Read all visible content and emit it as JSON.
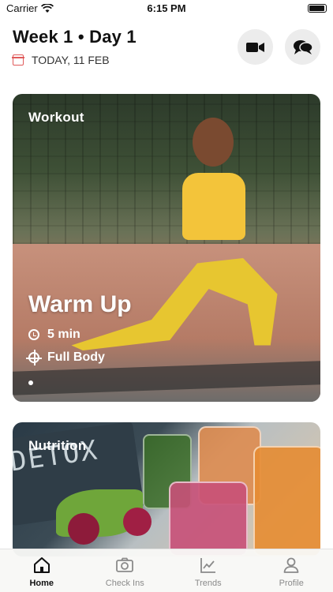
{
  "status_bar": {
    "carrier": "Carrier",
    "time": "6:15 PM"
  },
  "header": {
    "title": "Week 1 • Day 1",
    "date": "TODAY, 11 FEB",
    "accent_color": "#e05a5a"
  },
  "workout_card": {
    "section_label": "Workout",
    "title": "Warm Up",
    "duration": "5 min",
    "focus": "Full Body",
    "page_index": 1
  },
  "nutrition_card": {
    "section_label": "Nutrition",
    "image_text": "DETOX"
  },
  "tab_bar": {
    "items": [
      {
        "label": "Home",
        "icon": "home-icon",
        "active": true
      },
      {
        "label": "Check Ins",
        "icon": "camera-icon",
        "active": false
      },
      {
        "label": "Trends",
        "icon": "chart-icon",
        "active": false
      },
      {
        "label": "Profile",
        "icon": "user-icon",
        "active": false
      }
    ]
  }
}
